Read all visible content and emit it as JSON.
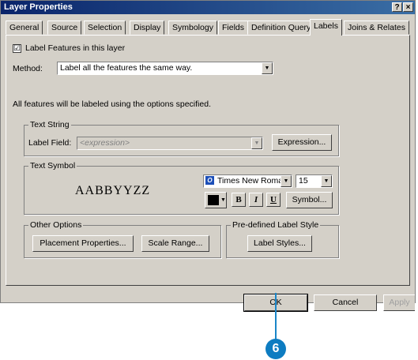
{
  "window": {
    "title": "Layer Properties",
    "help_btn": "?",
    "close_btn": "×"
  },
  "tabs": [
    "General",
    "Source",
    "Selection",
    "Display",
    "Symbology",
    "Fields",
    "Definition Query",
    "Labels",
    "Joins & Relates"
  ],
  "active_tab": "Labels",
  "label_features": {
    "checked": "☑",
    "label": "Label Features in this layer"
  },
  "method": {
    "label": "Method:",
    "value": "Label all the features the same way."
  },
  "info_text": "All features will be labeled using the options specified.",
  "text_string": {
    "group_label": "Text String",
    "field_label": "Label Field:",
    "field_value": "<expression>",
    "expression_btn": "Expression..."
  },
  "text_symbol": {
    "group_label": "Text Symbol",
    "sample": "AABBYYZZ",
    "font_icon": "O",
    "font_value": "Times New Roma",
    "size_value": "15",
    "bold": "B",
    "italic": "I",
    "underline": "U",
    "symbol_btn": "Symbol...",
    "color": "#000000"
  },
  "other_options": {
    "group_label": "Other Options",
    "placement_btn": "Placement Properties...",
    "scale_btn": "Scale Range..."
  },
  "predefined": {
    "group_label": "Pre-defined Label Style",
    "label_styles_btn": "Label Styles..."
  },
  "footer": {
    "ok": "OK",
    "cancel": "Cancel",
    "apply": "Apply"
  },
  "callout": {
    "number": "6",
    "color": "#0d7cc1"
  }
}
